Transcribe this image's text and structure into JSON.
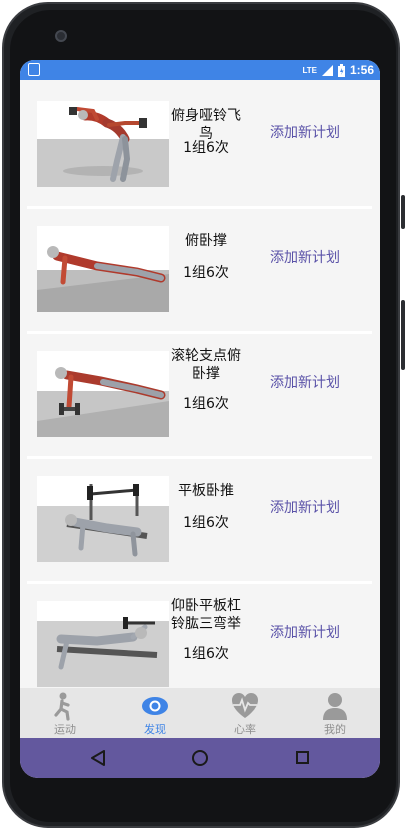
{
  "status_bar": {
    "network": "LTE",
    "time": "1:56",
    "color": "#3f84e6"
  },
  "exercises": [
    {
      "name": "俯身哑铃飞鸟",
      "sets": "1组6次",
      "action": "添加新计划",
      "image_icon": "bent-over-dumbbell-fly-figure"
    },
    {
      "name": "俯卧撑",
      "sets": "1组6次",
      "action": "添加新计划",
      "image_icon": "push-up-figure"
    },
    {
      "name": "滚轮支点俯卧撑",
      "sets": "1组6次",
      "action": "添加新计划",
      "image_icon": "dumbbell-push-up-figure"
    },
    {
      "name": "平板卧推",
      "sets": "1组6次",
      "action": "添加新计划",
      "image_icon": "flat-bench-press-figure"
    },
    {
      "name": "仰卧平板杠铃肱三弯举",
      "sets": "1组6次",
      "action": "添加新计划",
      "image_icon": "lying-triceps-extension-figure"
    }
  ],
  "tabs": [
    {
      "label": "运动",
      "icon": "running-person-icon",
      "active": false
    },
    {
      "label": "发现",
      "icon": "eye-icon",
      "active": true
    },
    {
      "label": "心率",
      "icon": "heart-rate-icon",
      "active": false
    },
    {
      "label": "我的",
      "icon": "user-icon",
      "active": false
    }
  ],
  "colors": {
    "accent": "#3f84e6",
    "action_text": "#5a52a8",
    "nav_bar": "#63589e",
    "tab_inactive": "#8f8f8f"
  }
}
